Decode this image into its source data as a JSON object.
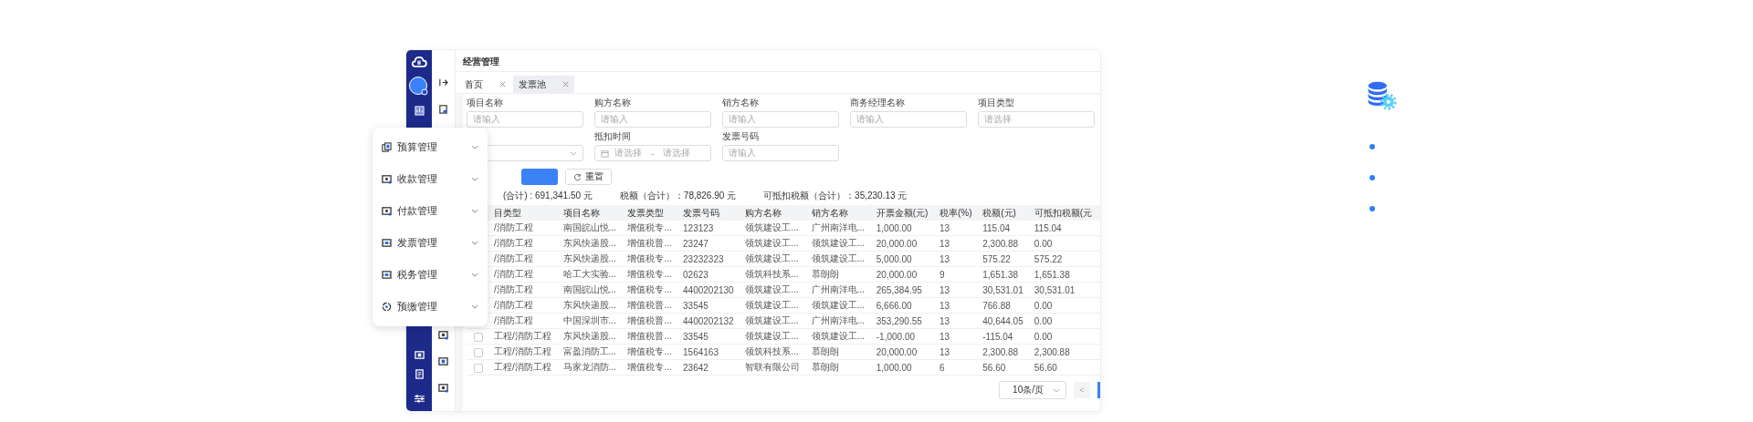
{
  "page_title": "经营管理",
  "tabs": [
    {
      "label": "首页",
      "selected": false
    },
    {
      "label": "发票池",
      "selected": true
    }
  ],
  "filters": [
    {
      "label": "项目名称",
      "placeholder": "请输入",
      "kind": "input"
    },
    {
      "label": "购方名称",
      "placeholder": "请输入",
      "kind": "input"
    },
    {
      "label": "销方名称",
      "placeholder": "请输入",
      "kind": "input"
    },
    {
      "label": "商务经理名称",
      "placeholder": "请输入",
      "kind": "input"
    },
    {
      "label": "项目类型",
      "placeholder": "请选择",
      "kind": "input"
    },
    {
      "kind": "select"
    },
    {
      "label": "抵扣时间",
      "placeholder": "请选择",
      "placeholder_end": "请选择",
      "separator": "-",
      "kind": "range"
    },
    {
      "label": "发票号码",
      "placeholder": "请输入",
      "kind": "input"
    }
  ],
  "reset_button": "重置",
  "totals": [
    "(合计) : 691,341.50 元",
    "税额（合计）：78,826.90 元",
    "可抵扣税额（合计）：35,230.13 元"
  ],
  "table": {
    "columns": [
      "目类型",
      "项目名称",
      "发票类型",
      "发票号码",
      "购方名称",
      "销方名称",
      "开票金额(元)",
      "税率(%)",
      "税额(元)",
      "可抵扣税额(元"
    ],
    "rows": [
      {
        "cells": [
          "/消防工程",
          "南国皖山悦...",
          "增值税专...",
          "123123",
          "领筑建设工...",
          "广州南洋电...",
          "1,000.00",
          "13",
          "115.04",
          "115.04"
        ]
      },
      {
        "cells": [
          "/消防工程",
          "东风快递股...",
          "增值税普...",
          "23247",
          "领筑建设工...",
          "领筑建设工...",
          "20,000.00",
          "13",
          "2,300.88",
          "0.00"
        ]
      },
      {
        "cells": [
          "/消防工程",
          "东风快递股...",
          "增值税专...",
          "23232323",
          "领筑建设工...",
          "领筑建设工...",
          "5,000.00",
          "13",
          "575.22",
          "575.22"
        ]
      },
      {
        "cells": [
          "/消防工程",
          "哈工大实验...",
          "增值税专...",
          "02623",
          "领筑科技系...",
          "慕朗朗",
          "20,000.00",
          "9",
          "1,651.38",
          "1,651.38"
        ]
      },
      {
        "cells": [
          "/消防工程",
          "南国皖山悦...",
          "增值税专...",
          "4400202130",
          "领筑建设工...",
          "广州南洋电...",
          "265,384.95",
          "13",
          "30,531.01",
          "30,531.01"
        ]
      },
      {
        "cells": [
          "/消防工程",
          "东风快递股...",
          "增值税普...",
          "33545",
          "领筑建设工...",
          "领筑建设工...",
          "6,666.00",
          "13",
          "766.88",
          "0.00"
        ]
      },
      {
        "cells": [
          "/消防工程",
          "中国深圳市...",
          "增值税普...",
          "4400202132",
          "领筑建设工...",
          "广州南洋电...",
          "353,290.55",
          "13",
          "40,644.05",
          "0.00"
        ]
      },
      {
        "checked": false,
        "cells": [
          "工程/消防工程",
          "东风快递股...",
          "增值税普...",
          "33545",
          "领筑建设工...",
          "领筑建设工...",
          "-1,000.00",
          "13",
          "-115.04",
          "0.00"
        ]
      },
      {
        "checked": false,
        "cells": [
          "工程/消防工程",
          "富盈消防工...",
          "增值税专...",
          "1564163",
          "领筑科技系...",
          "慕朗朗",
          "20,000.00",
          "13",
          "2,300.88",
          "2,300.88"
        ]
      },
      {
        "checked": false,
        "cells": [
          "工程/消防工程",
          "马家龙消防...",
          "增值税专...",
          "23642",
          "智联有限公司",
          "慕朗朗",
          "1,000.00",
          "6",
          "56.60",
          "56.60"
        ]
      }
    ]
  },
  "page_size": "10条/页",
  "prev_page": "<",
  "menu": [
    {
      "label": "预算管理",
      "kind": "stack"
    },
    {
      "label": "收款管理",
      "kind": "screen"
    },
    {
      "label": "付款管理",
      "kind": "screen"
    },
    {
      "label": "发票管理",
      "kind": "ticket"
    },
    {
      "label": "税务管理",
      "kind": "ticket"
    },
    {
      "label": "预缴管理",
      "kind": "cycle"
    }
  ]
}
